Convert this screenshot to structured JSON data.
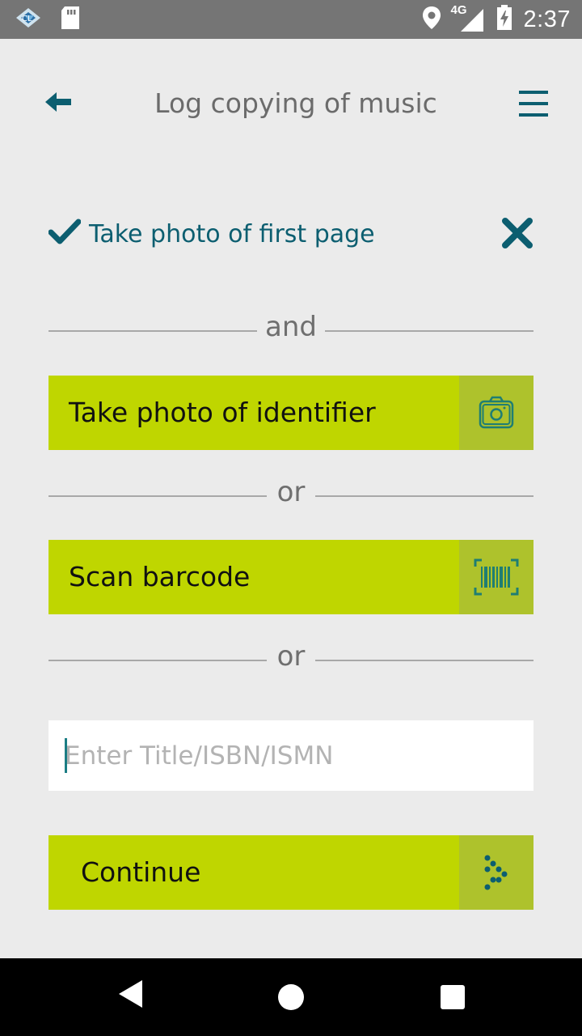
{
  "status_bar": {
    "time": "2:37",
    "network": "4G",
    "icons": [
      "app-notification-icon",
      "sd-card-icon",
      "location-icon",
      "signal-icon",
      "battery-charging-icon"
    ]
  },
  "header": {
    "title": "Log copying of music",
    "back_icon": "back-arrow-icon",
    "menu_icon": "hamburger-menu-icon"
  },
  "completed_step": {
    "label": "Take photo of first page",
    "check_icon": "checkmark-icon",
    "remove_icon": "close-icon"
  },
  "separators": {
    "and": "and",
    "or_1": "or",
    "or_2": "or"
  },
  "actions": {
    "photo_identifier": {
      "label": "Take photo of identifier",
      "icon": "camera-icon"
    },
    "scan_barcode": {
      "label": "Scan barcode",
      "icon": "barcode-scan-icon"
    },
    "continue": {
      "label": "Continue",
      "icon": "dotted-arrow-icon"
    }
  },
  "search": {
    "placeholder": "Enter Title/ISBN/ISMN",
    "value": ""
  },
  "nav_bar": {
    "icons": [
      "back-triangle-icon",
      "home-circle-icon",
      "recents-square-icon"
    ]
  },
  "colors": {
    "accent_green": "#bfd600",
    "icon_box_green": "#aec22c",
    "teal": "#0c5e70",
    "background": "#ebebeb"
  }
}
